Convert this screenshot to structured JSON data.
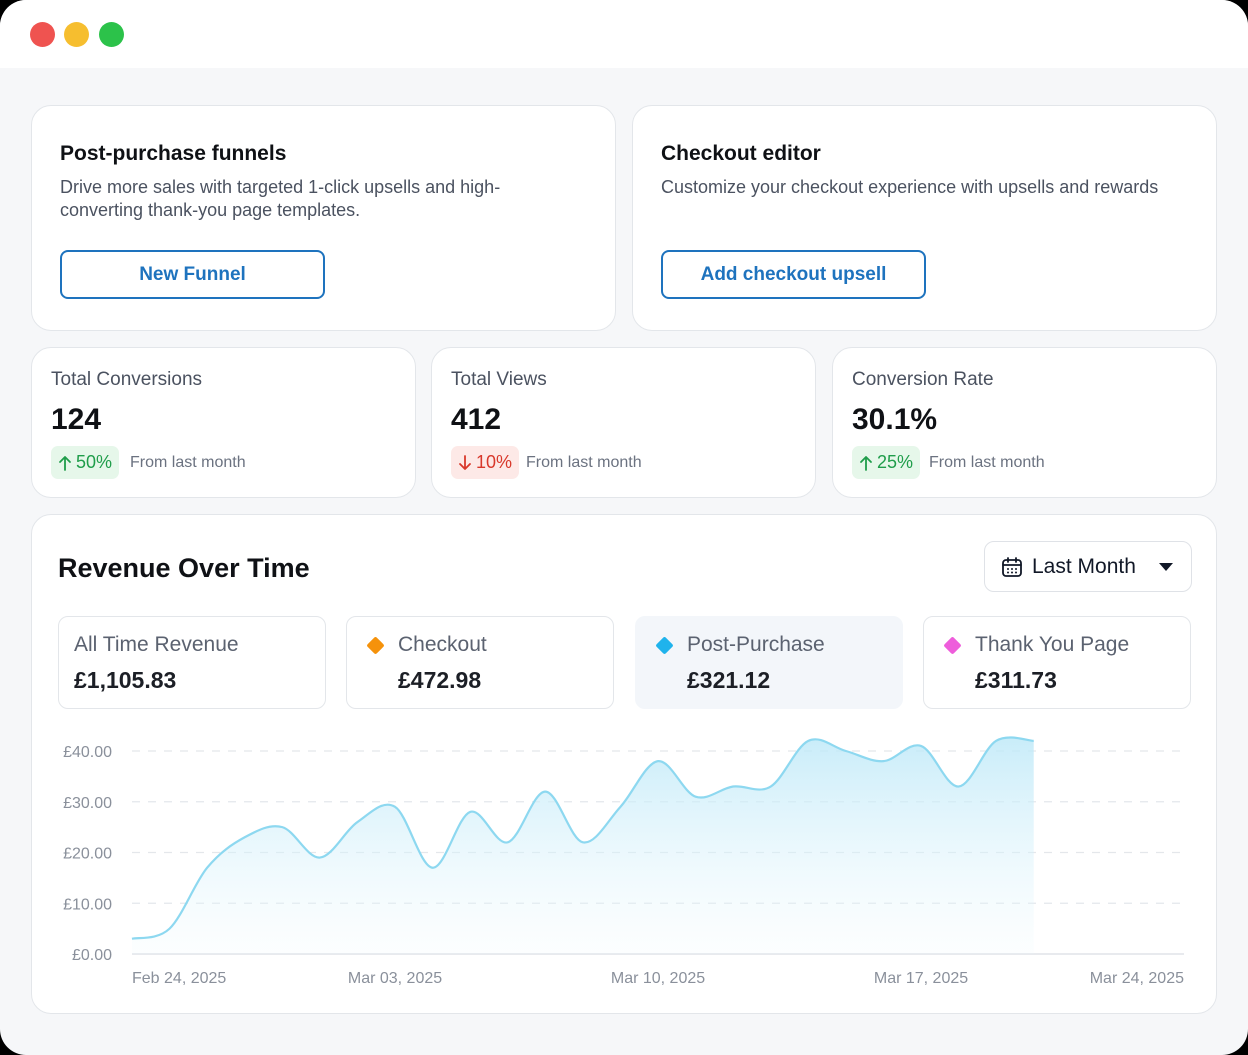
{
  "funnels": {
    "title": "Post-purchase funnels",
    "description": "Drive more sales with targeted 1-click upsells and high-converting thank-you page templates.",
    "button_label": "New Funnel"
  },
  "checkout": {
    "title": "Checkout editor",
    "description": "Customize your checkout experience with upsells and rewards",
    "button_label": "Add checkout upsell"
  },
  "stats": [
    {
      "label": "Total Conversions",
      "value": "124",
      "change": "50%",
      "direction": "up",
      "from": "From last month"
    },
    {
      "label": "Total Views",
      "value": "412",
      "change": "10%",
      "direction": "down",
      "from": "From last month"
    },
    {
      "label": "Conversion Rate",
      "value": "30.1%",
      "change": "25%",
      "direction": "up",
      "from": "From last month"
    }
  ],
  "revenue": {
    "title": "Revenue Over Time",
    "period": "Last Month",
    "metrics": [
      {
        "label": "All Time Revenue",
        "value": "£1,105.83"
      },
      {
        "label": "Checkout",
        "value": "£472.98",
        "color": "#f5920b"
      },
      {
        "label": "Post-Purchase",
        "value": "£321.12",
        "color": "#1fb3ec"
      },
      {
        "label": "Thank You Page",
        "value": "£311.73",
        "color": "#ee5ddb"
      }
    ]
  },
  "colors": {
    "accent": "#1e73be",
    "positive": "#1f9d4a",
    "negative": "#d8382b",
    "line": "#8dd8f0"
  },
  "chart_data": {
    "type": "area",
    "x": [
      "2025-02-24",
      "2025-02-25",
      "2025-02-26",
      "2025-02-27",
      "2025-02-28",
      "2025-03-01",
      "2025-03-02",
      "2025-03-03",
      "2025-03-04",
      "2025-03-05",
      "2025-03-06",
      "2025-03-07",
      "2025-03-08",
      "2025-03-09",
      "2025-03-10",
      "2025-03-11",
      "2025-03-12",
      "2025-03-13",
      "2025-03-14",
      "2025-03-15",
      "2025-03-16",
      "2025-03-17",
      "2025-03-18",
      "2025-03-19",
      "2025-03-20"
    ],
    "values": [
      3,
      5,
      17,
      23,
      25,
      19,
      26,
      29,
      17,
      28,
      22,
      32,
      22,
      29,
      38,
      31,
      33,
      33,
      42,
      40,
      38,
      41,
      33,
      42,
      42
    ],
    "xticks": [
      "Feb 24, 2025",
      "Mar 03, 2025",
      "Mar 10, 2025",
      "Mar 17, 2025",
      "Mar 24, 2025"
    ],
    "yticks": [
      "£0.00",
      "£10.00",
      "£20.00",
      "£30.00",
      "£40.00"
    ],
    "ylim": [
      0,
      40
    ],
    "grid": true
  }
}
